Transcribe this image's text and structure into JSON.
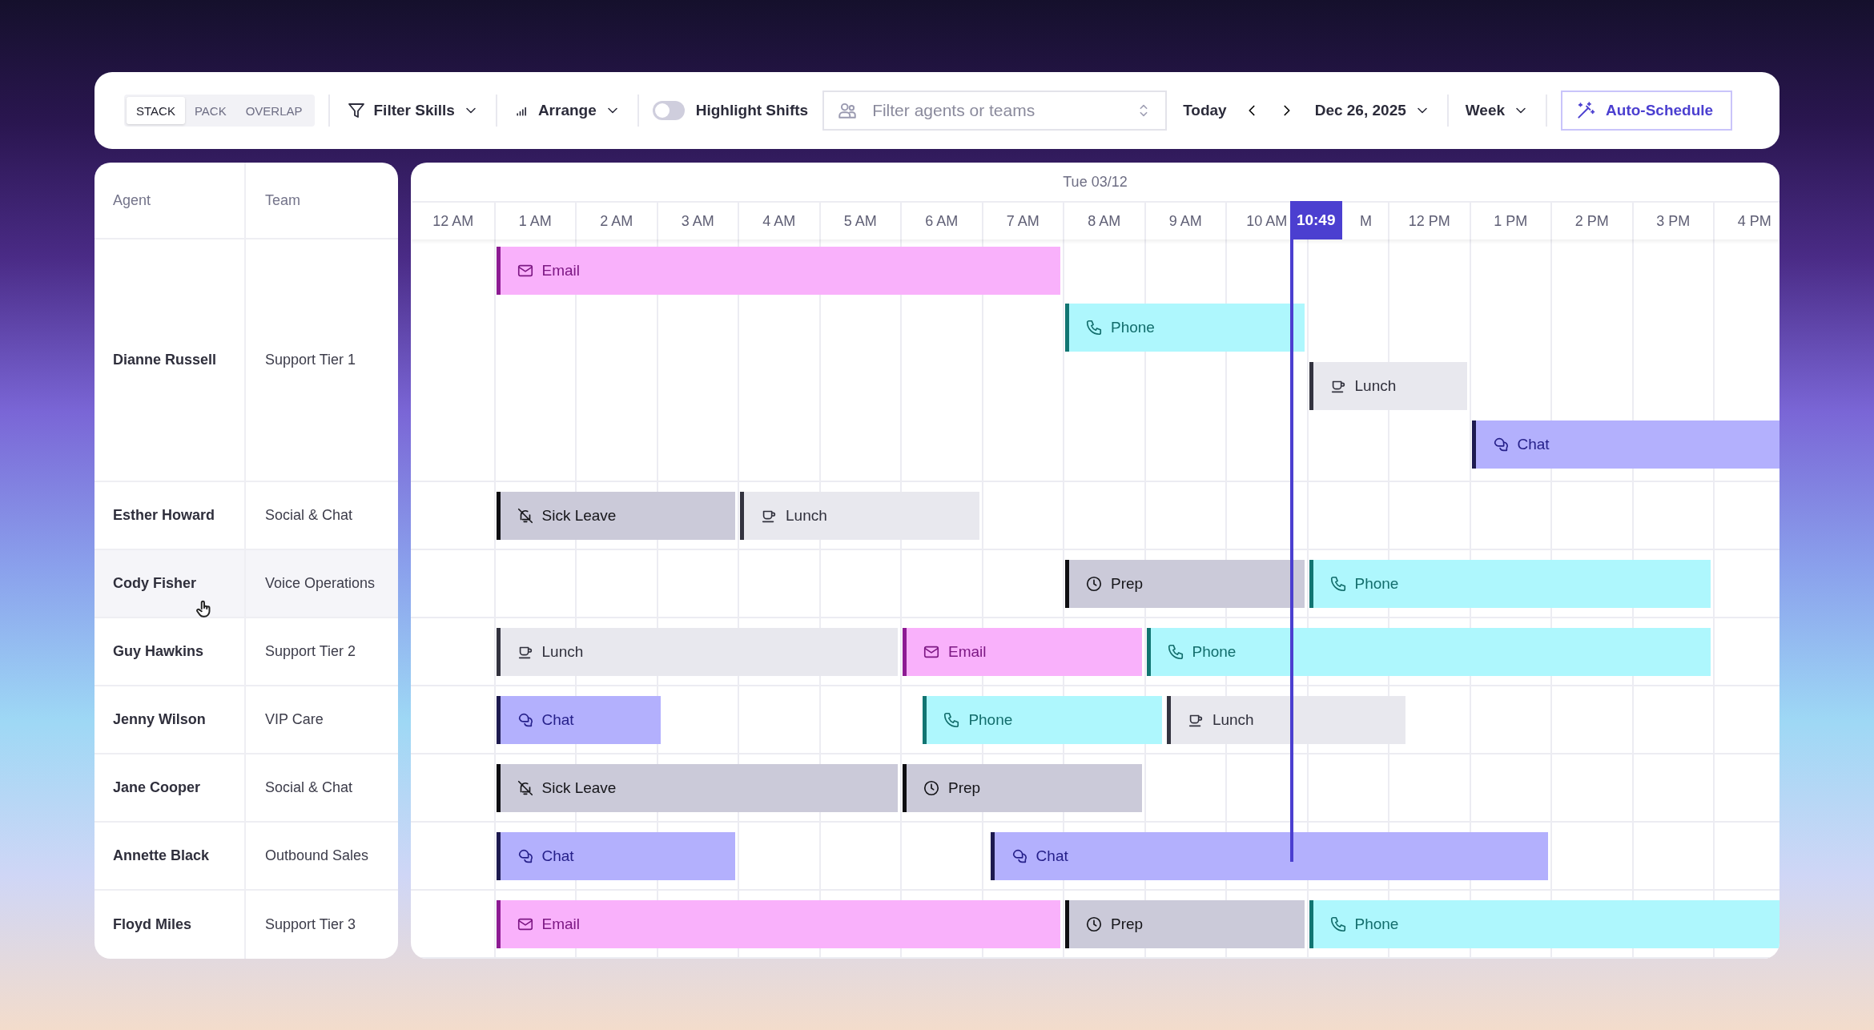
{
  "toolbar": {
    "layout_modes": [
      {
        "label": "STACK",
        "selected": true
      },
      {
        "label": "PACK",
        "selected": false
      },
      {
        "label": "OVERLAP",
        "selected": false
      }
    ],
    "filter_skills": "Filter Skills",
    "arrange": "Arrange",
    "highlight_shifts": {
      "label": "Highlight Shifts",
      "on": false
    },
    "agent_filter": {
      "placeholder": "Filter agents or teams"
    },
    "today": "Today",
    "date": "Dec 26, 2025",
    "view": "Week",
    "auto_schedule": "Auto-Schedule"
  },
  "agents_table": {
    "columns": [
      "Agent",
      "Team"
    ],
    "rows": [
      {
        "agent": "Dianne Russell",
        "team": "Support Tier 1",
        "hovered": false
      },
      {
        "agent": "Esther Howard",
        "team": "Social & Chat",
        "hovered": false
      },
      {
        "agent": "Cody Fisher",
        "team": "Voice Operations",
        "hovered": true
      },
      {
        "agent": "Guy Hawkins",
        "team": "Support Tier 2",
        "hovered": false
      },
      {
        "agent": "Jenny Wilson",
        "team": "VIP Care",
        "hovered": false
      },
      {
        "agent": "Jane Cooper",
        "team": "Social & Chat",
        "hovered": false
      },
      {
        "agent": "Annette Black",
        "team": "Outbound Sales",
        "hovered": false
      },
      {
        "agent": "Floyd Miles",
        "team": "Support Tier 3",
        "hovered": false
      }
    ]
  },
  "timeline": {
    "date": "Tue 03/12",
    "now": "10:49",
    "hours": [
      {
        "label": "12 AM",
        "partial": false
      },
      {
        "label": "1 AM",
        "partial": false
      },
      {
        "label": "2 AM",
        "partial": false
      },
      {
        "label": "3 AM",
        "partial": false
      },
      {
        "label": "4 AM",
        "partial": false
      },
      {
        "label": "5 AM",
        "partial": false
      },
      {
        "label": "6 AM",
        "partial": false
      },
      {
        "label": "7 AM",
        "partial": false
      },
      {
        "label": "8 AM",
        "partial": false
      },
      {
        "label": "9 AM",
        "partial": false
      },
      {
        "label": "10 AM",
        "partial": false
      },
      {
        "label": "M",
        "partial": true
      },
      {
        "label": "12 PM",
        "partial": false
      },
      {
        "label": "1 PM",
        "partial": false
      },
      {
        "label": "2 PM",
        "partial": false
      },
      {
        "label": "3 PM",
        "partial": false
      },
      {
        "label": "4 PM",
        "partial": false
      }
    ],
    "rows": [
      {
        "lanes": [
          [
            {
              "kind": "email",
              "label": "Email"
            }
          ],
          [
            {
              "kind": "phone",
              "label": "Phone"
            }
          ],
          [
            {
              "kind": "lunch",
              "label": "Lunch"
            }
          ],
          [
            {
              "kind": "chat",
              "label": "Chat"
            }
          ]
        ]
      },
      {
        "lanes": [
          [
            {
              "kind": "sick",
              "label": "Sick Leave"
            },
            {
              "kind": "lunch",
              "label": "Lunch"
            }
          ]
        ]
      },
      {
        "lanes": [
          [
            {
              "kind": "prep",
              "label": "Prep"
            },
            {
              "kind": "phone",
              "label": "Phone"
            }
          ]
        ]
      },
      {
        "lanes": [
          [
            {
              "kind": "lunch",
              "label": "Lunch"
            },
            {
              "kind": "email",
              "label": "Email"
            },
            {
              "kind": "phone",
              "label": "Phone"
            }
          ]
        ]
      },
      {
        "lanes": [
          [
            {
              "kind": "chat",
              "label": "Chat"
            },
            {
              "kind": "phone",
              "label": "Phone"
            },
            {
              "kind": "lunch",
              "label": "Lunch"
            }
          ]
        ]
      },
      {
        "lanes": [
          [
            {
              "kind": "sick",
              "label": "Sick Leave"
            },
            {
              "kind": "prep",
              "label": "Prep"
            }
          ]
        ]
      },
      {
        "lanes": [
          [
            {
              "kind": "chat",
              "label": "Chat"
            },
            {
              "kind": "chat",
              "label": "Chat"
            }
          ]
        ]
      },
      {
        "lanes": [
          [
            {
              "kind": "email",
              "label": "Email"
            },
            {
              "kind": "prep",
              "label": "Prep"
            },
            {
              "kind": "phone",
              "label": "Phone"
            }
          ]
        ]
      }
    ]
  }
}
